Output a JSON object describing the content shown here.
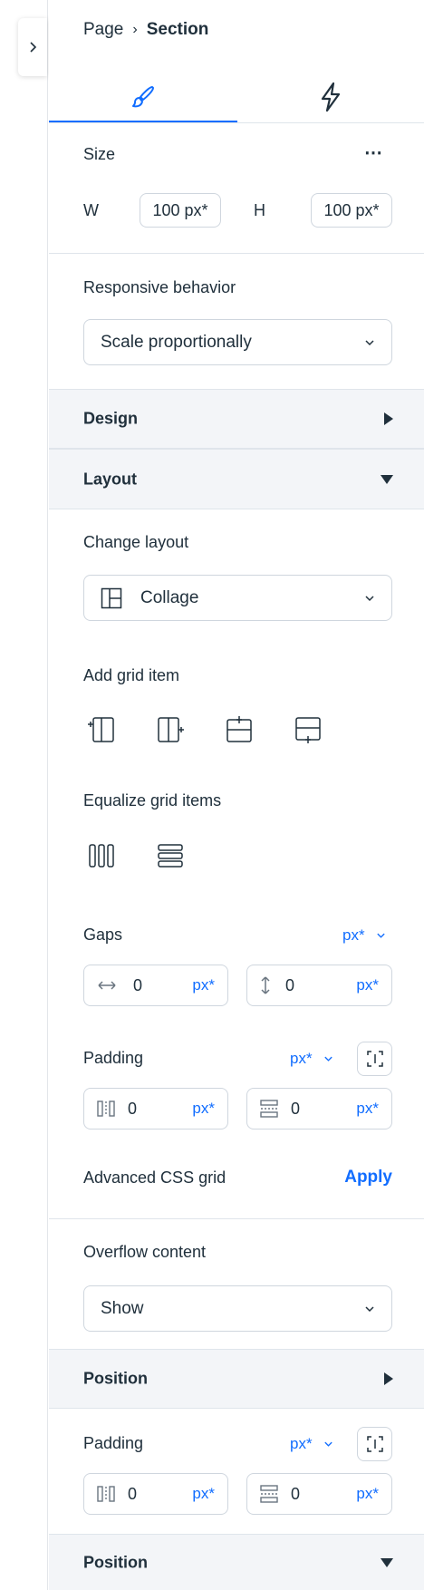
{
  "breadcrumb": {
    "page": "Page",
    "separator": "›",
    "section": "Section"
  },
  "tabs": [
    {
      "icon": "brush-icon",
      "active": true
    },
    {
      "icon": "lightning-icon",
      "active": false
    }
  ],
  "size": {
    "title": "Size",
    "more": "⋯",
    "w_label": "W",
    "w_value": "100 px*",
    "h_label": "H",
    "h_value": "100 px*"
  },
  "responsive": {
    "label": "Responsive behavior",
    "value": "Scale proportionally"
  },
  "design": {
    "title": "Design",
    "state": "collapsed"
  },
  "layout": {
    "title": "Layout",
    "state": "expanded",
    "change_layout_label": "Change layout",
    "change_layout_value": "Collage",
    "add_grid_item_label": "Add grid item",
    "add_grid_item_icons": [
      "add-column-left-icon",
      "add-column-right-icon",
      "add-row-top-icon",
      "add-row-bottom-icon"
    ],
    "equalize_label": "Equalize grid items",
    "equalize_icons": [
      "equalize-columns-icon",
      "equalize-rows-icon"
    ],
    "gaps": {
      "label": "Gaps",
      "unit_select": "px*",
      "horizontal_value": "0",
      "horizontal_unit": "px*",
      "vertical_value": "0",
      "vertical_unit": "px*"
    },
    "padding": {
      "label": "Padding",
      "unit_select": "px*",
      "horizontal_value": "0",
      "horizontal_unit": "px*",
      "vertical_value": "0",
      "vertical_unit": "px*"
    },
    "advanced": {
      "label": "Advanced CSS grid",
      "action": "Apply"
    }
  },
  "overflow": {
    "label": "Overflow content",
    "value": "Show"
  },
  "position_1": {
    "title": "Position",
    "state": "collapsed"
  },
  "padding_2": {
    "label": "Padding",
    "unit_select": "px*",
    "horizontal_value": "0",
    "horizontal_unit": "px*",
    "vertical_value": "0",
    "vertical_unit": "px*"
  },
  "position_2": {
    "title": "Position",
    "state": "expanded"
  },
  "colors": {
    "accent": "#116dff",
    "text": "#20303c",
    "border": "#cfd6de",
    "section_bg": "#f3f5f8"
  }
}
